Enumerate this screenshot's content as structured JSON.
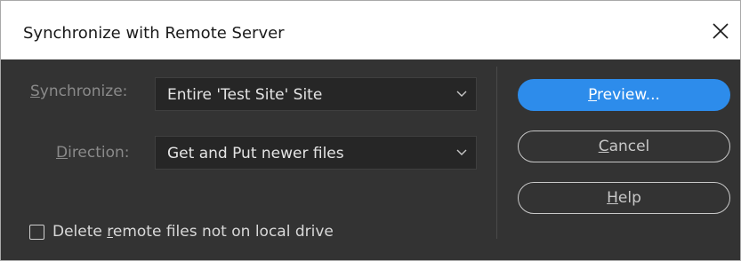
{
  "window": {
    "title": "Synchronize with Remote Server"
  },
  "form": {
    "synchronize_label_prefix": "S",
    "synchronize_label_rest": "ynchronize:",
    "synchronize_value": "Entire 'Test Site' Site",
    "direction_label_prefix": "D",
    "direction_label_rest": "irection:",
    "direction_value": "Get and Put newer files",
    "delete_label_start": "Delete ",
    "delete_label_mnemonic": "r",
    "delete_label_end": "emote files not on local drive",
    "delete_checked": false
  },
  "buttons": {
    "preview_mnemonic": "P",
    "preview_rest": "review...",
    "cancel_mnemonic": "C",
    "cancel_rest": "ancel",
    "help_mnemonic": "H",
    "help_rest": "elp"
  },
  "colors": {
    "background": "#333333",
    "primary_button": "#2d8ceb",
    "dropdown_bg": "#262626"
  },
  "icons": {
    "close": "close-icon",
    "dropdown": "chevron-down-icon",
    "checkbox": "checkbox-unchecked-icon"
  }
}
